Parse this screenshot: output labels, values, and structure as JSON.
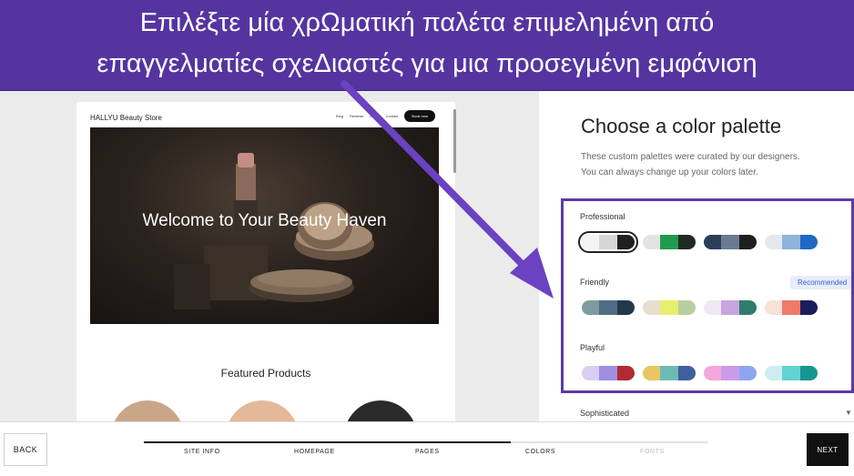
{
  "annotation": {
    "line1": "Επιλέξτε μία χρΩματική παλέτα επιμελημένη από",
    "line2": "επαγγελματίες σχεΔιαστές για μια προσεγμένη εμφάνιση"
  },
  "site_preview": {
    "store_name": "HALLYU Beauty Store",
    "nav": [
      "Blog",
      "Reviews",
      "About",
      "Contact"
    ],
    "cta": "Book now",
    "hero_title": "Welcome to Your Beauty Haven",
    "featured_title": "Featured Products",
    "product_colors": [
      "#c9a688",
      "#e3b99a",
      "#2a2a2a"
    ]
  },
  "panel": {
    "title": "Choose a color palette",
    "description_line1": "These custom palettes were curated by our designers.",
    "description_line2": "You can always change up your colors later.",
    "recommended_badge": "Recommended",
    "sophisticated_label": "Sophisticated",
    "groups": [
      {
        "label": "Professional",
        "palettes": [
          {
            "selected": true,
            "colors": [
              "#f3f3f3",
              "#d6d6d6",
              "#1f1f1f"
            ]
          },
          {
            "selected": false,
            "colors": [
              "#e3e3e3",
              "#1f9a4f",
              "#1f2b22"
            ]
          },
          {
            "selected": false,
            "colors": [
              "#2c3e5c",
              "#6b7b8f",
              "#1f1f1f"
            ]
          },
          {
            "selected": false,
            "colors": [
              "#e4e8ee",
              "#8fb3da",
              "#2167c4"
            ]
          }
        ]
      },
      {
        "label": "Friendly",
        "palettes": [
          {
            "selected": false,
            "colors": [
              "#7f9aa0",
              "#4d6d85",
              "#24384a"
            ]
          },
          {
            "selected": false,
            "colors": [
              "#e8ded0",
              "#e6f06e",
              "#b7cfa0"
            ]
          },
          {
            "selected": false,
            "colors": [
              "#efe8f3",
              "#c6a6dc",
              "#2f7c6c"
            ]
          },
          {
            "selected": false,
            "colors": [
              "#f6e2d6",
              "#ef7a6a",
              "#1a1e5a"
            ]
          }
        ]
      },
      {
        "label": "Playful",
        "palettes": [
          {
            "selected": false,
            "colors": [
              "#d8cdf2",
              "#9f8ee0",
              "#b22a35"
            ]
          },
          {
            "selected": false,
            "colors": [
              "#e8c664",
              "#6dbab5",
              "#3f5f9e"
            ]
          },
          {
            "selected": false,
            "colors": [
              "#f4a6dc",
              "#cc9be8",
              "#8ea6f0"
            ]
          },
          {
            "selected": false,
            "colors": [
              "#cdeef0",
              "#62d3d0",
              "#17958f"
            ]
          }
        ]
      }
    ]
  },
  "bottom_bar": {
    "back_label": "BACK",
    "next_label": "NEXT",
    "progress": 0.65,
    "steps": [
      {
        "label": "SITE INFO",
        "state": "done"
      },
      {
        "label": "HOMEPAGE",
        "state": "done"
      },
      {
        "label": "PAGES",
        "state": "done"
      },
      {
        "label": "COLORS",
        "state": "current"
      },
      {
        "label": "FONTS",
        "state": "future"
      }
    ]
  },
  "colors": {
    "annotation_purple": "#5534a0",
    "highlight_border": "#5b3aa8",
    "arrow": "#6a42c2"
  }
}
